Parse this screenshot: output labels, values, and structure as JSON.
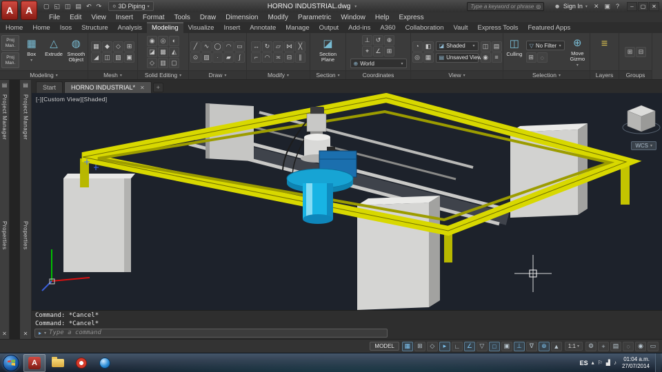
{
  "colors": {
    "frame_yellow": "#d8d800",
    "pillar_gray": "#d2d2d0",
    "burner_cyan": "#17b2e2",
    "viewport_bg": "#1d222b",
    "accent_red": "#b5332c"
  },
  "titlebar": {
    "logo_letter": "A",
    "workspace": "3D Piping",
    "doc_title": "HORNO INDUSTRIAL.dwg",
    "search_placeholder": "Type a keyword or phrase",
    "sign_in": "Sign In",
    "quick_icons": [
      {
        "name": "new-file-icon",
        "glyph": "▢"
      },
      {
        "name": "open-file-icon",
        "glyph": "◱"
      },
      {
        "name": "save-icon",
        "glyph": "◫"
      },
      {
        "name": "plot-icon",
        "glyph": "▤"
      },
      {
        "name": "undo-icon",
        "glyph": "↶"
      },
      {
        "name": "redo-icon",
        "glyph": "↷"
      }
    ],
    "right_icons": [
      {
        "name": "exchange-apps-icon",
        "glyph": "✕"
      },
      {
        "name": "keep-me-connected-icon",
        "glyph": "▣"
      },
      {
        "name": "help-icon",
        "glyph": "?"
      }
    ],
    "window_controls": [
      {
        "name": "minimize-button",
        "glyph": "–"
      },
      {
        "name": "restore-button",
        "glyph": "▢"
      },
      {
        "name": "close-button",
        "glyph": "✕"
      }
    ]
  },
  "menubar": {
    "items": [
      "File",
      "Edit",
      "View",
      "Insert",
      "Format",
      "Tools",
      "Draw",
      "Dimension",
      "Modify",
      "Parametric",
      "Window",
      "Help",
      "Express"
    ]
  },
  "ribbon_tabs": [
    {
      "label": "Home"
    },
    {
      "label": "Home"
    },
    {
      "label": "Isos"
    },
    {
      "label": "Structure"
    },
    {
      "label": "Analysis"
    },
    {
      "label": "Modeling",
      "active": true
    },
    {
      "label": "Visualize"
    },
    {
      "label": "Insert"
    },
    {
      "label": "Annotate"
    },
    {
      "label": "Manage"
    },
    {
      "label": "Output"
    },
    {
      "label": "Add-ins"
    },
    {
      "label": "A360"
    },
    {
      "label": "Collaboration"
    },
    {
      "label": "Vault"
    },
    {
      "label": "Express Tools"
    },
    {
      "label": "Featured Apps"
    }
  ],
  "ribbon": {
    "project_buttons": [
      {
        "name": "project-manager-ribbon-button",
        "label": "Proj Man."
      },
      {
        "name": "project-data-ribbon-button",
        "label": "Proj Man."
      }
    ],
    "modeling": {
      "label": "Modeling",
      "box_label": "Box",
      "extrude_label": "Extrude",
      "smooth_label": "Smooth Object"
    },
    "mesh": {
      "label": "Mesh",
      "icons": [
        {
          "name": "mesh-box-icon",
          "glyph": "▦"
        },
        {
          "name": "mesh-smooth-more-icon",
          "glyph": "◆"
        },
        {
          "name": "mesh-smooth-less-icon",
          "glyph": "◇"
        },
        {
          "name": "mesh-refine-icon",
          "glyph": "⊞"
        },
        {
          "name": "mesh-crease-icon",
          "glyph": "◢"
        },
        {
          "name": "mesh-split-icon",
          "glyph": "◫"
        },
        {
          "name": "mesh-extrude-face-icon",
          "glyph": "▧"
        },
        {
          "name": "mesh-cap-icon",
          "glyph": "▣"
        }
      ]
    },
    "solid": {
      "label": "Solid Editing",
      "icons": [
        {
          "name": "solid-union-icon",
          "glyph": "◉"
        },
        {
          "name": "solid-subtract-icon",
          "glyph": "◎"
        },
        {
          "name": "solid-intersect-icon",
          "glyph": "◐"
        },
        {
          "name": "slice-icon",
          "glyph": "◪"
        },
        {
          "name": "thicken-icon",
          "glyph": "▩"
        },
        {
          "name": "interfere-icon",
          "glyph": "◭"
        },
        {
          "name": "extract-edges-icon",
          "glyph": "◇"
        },
        {
          "name": "imprint-icon",
          "glyph": "▥"
        },
        {
          "name": "shell-icon",
          "glyph": "▢"
        }
      ]
    },
    "draw": {
      "label": "Draw",
      "icons": [
        {
          "name": "line-icon",
          "glyph": "╱"
        },
        {
          "name": "polyline-icon",
          "glyph": "∿"
        },
        {
          "name": "circle-icon",
          "glyph": "◯"
        },
        {
          "name": "arc-icon",
          "glyph": "◠"
        },
        {
          "name": "rectangle-icon",
          "glyph": "▭"
        },
        {
          "name": "ellipse-icon",
          "glyph": "⊙"
        },
        {
          "name": "hatch-icon",
          "glyph": "▨"
        },
        {
          "name": "point-icon",
          "glyph": "∙"
        },
        {
          "name": "region-icon",
          "glyph": "▰"
        },
        {
          "name": "spline-icon",
          "glyph": "∫"
        }
      ]
    },
    "modify": {
      "label": "Modify",
      "icons": [
        {
          "name": "move-icon",
          "glyph": "↔"
        },
        {
          "name": "rotate-icon",
          "glyph": "↻"
        },
        {
          "name": "offset-icon",
          "glyph": "▱"
        },
        {
          "name": "mirror-icon",
          "glyph": "⋈"
        },
        {
          "name": "erase-icon",
          "glyph": "╳"
        },
        {
          "name": "trim-icon",
          "glyph": "⌐"
        },
        {
          "name": "fillet-icon",
          "glyph": "◠"
        },
        {
          "name": "align-icon",
          "glyph": "≍"
        },
        {
          "name": "explode-icon",
          "glyph": "⊟"
        },
        {
          "name": "array-icon",
          "glyph": "∥"
        }
      ]
    },
    "section": {
      "label": "Section",
      "button_label": "Section Plane"
    },
    "coordinates": {
      "label": "Coordinates",
      "world_label": "World",
      "icons": [
        {
          "name": "ucs-icon",
          "glyph": "⊥"
        },
        {
          "name": "ucs-previous-icon",
          "glyph": "↺"
        },
        {
          "name": "ucs-world-icon",
          "glyph": "⊕"
        },
        {
          "name": "ucs-origin-icon",
          "glyph": "⌖"
        },
        {
          "name": "ucs-z-axis-icon",
          "glyph": "∠"
        },
        {
          "name": "ucs-3point-icon",
          "glyph": "⊞"
        }
      ]
    },
    "view": {
      "label": "View",
      "visual_style": "Shaded",
      "saved_view": "Unsaved View",
      "icons_left": [
        {
          "name": "orbit-icon",
          "glyph": "◔"
        },
        {
          "name": "pan-icon",
          "glyph": "◧"
        },
        {
          "name": "zoom-icon",
          "glyph": "◎"
        },
        {
          "name": "zoom-extents-icon",
          "glyph": "▦"
        }
      ],
      "icons_right": [
        {
          "name": "viewport-config-icon",
          "glyph": "◫"
        },
        {
          "name": "view-manager-icon",
          "glyph": "▤"
        },
        {
          "name": "camera-icon",
          "glyph": "◉"
        },
        {
          "name": "show-motion-icon",
          "glyph": "≡"
        }
      ]
    },
    "selection": {
      "label": "Selection",
      "culling_label": "Culling",
      "no_filter_label": "No Filter",
      "move_gizmo_label": "Move Gizmo",
      "filter_icons": [
        {
          "name": "selection-window-icon",
          "glyph": "⊞"
        },
        {
          "name": "selection-lasso-icon",
          "glyph": "◌"
        }
      ]
    },
    "layers": {
      "label": "Layers"
    },
    "groups": {
      "label": "Groups",
      "icons": [
        {
          "name": "group-icon",
          "glyph": "⊞"
        },
        {
          "name": "ungroup-icon",
          "glyph": "⊟"
        }
      ]
    }
  },
  "file_tabs": {
    "start_label": "Start",
    "active_label": "HORNO INDUSTRIAL*"
  },
  "palettes": {
    "strip1": [
      "Project Manager",
      "Properties"
    ],
    "strip2": [
      "Project Manager",
      "Properties"
    ]
  },
  "viewport": {
    "label": "[-][Custom View][Shaded]",
    "wcs_label": "WCS"
  },
  "command": {
    "lines": [
      "Command: *Cancel*",
      "Command: *Cancel*"
    ],
    "placeholder": "Type a command"
  },
  "statusbar": {
    "model_label": "MODEL",
    "scale_label": "1:1",
    "left_icons": [
      {
        "name": "grid-icon",
        "glyph": "▦",
        "active": true
      },
      {
        "name": "snap-icon",
        "glyph": "⊞"
      },
      {
        "name": "infer-constraints-icon",
        "glyph": "◇"
      },
      {
        "name": "dynamic-input-icon",
        "glyph": "▸",
        "active": true
      },
      {
        "name": "ortho-icon",
        "glyph": "∟"
      },
      {
        "name": "polar-tracking-icon",
        "glyph": "∠",
        "active": true
      },
      {
        "name": "isodraft-icon",
        "glyph": "▽"
      },
      {
        "name": "osnap-icon",
        "glyph": "□",
        "active": true
      },
      {
        "name": "3d-osnap-icon",
        "glyph": "▣"
      },
      {
        "name": "dynamic-ucs-icon",
        "glyph": "⊥",
        "active": true
      },
      {
        "name": "selection-filter-icon",
        "glyph": "∇"
      },
      {
        "name": "gizmo-icon",
        "glyph": "⊕",
        "active": true
      },
      {
        "name": "annotation-visibility-icon",
        "glyph": "▲"
      }
    ],
    "right_icons": [
      {
        "name": "workspace-switching-icon",
        "glyph": "⚙"
      },
      {
        "name": "annotation-monitor-icon",
        "glyph": "+"
      },
      {
        "name": "quick-properties-icon",
        "glyph": "▤"
      },
      {
        "name": "isolate-objects-icon",
        "glyph": "◌"
      },
      {
        "name": "graphics-performance-icon",
        "glyph": "◉"
      },
      {
        "name": "clean-screen-icon",
        "glyph": "▭"
      }
    ]
  },
  "taskbar": {
    "language": "ES",
    "time": "01:04 a.m.",
    "date": "27/07/2014",
    "autocad_letter": "A"
  }
}
